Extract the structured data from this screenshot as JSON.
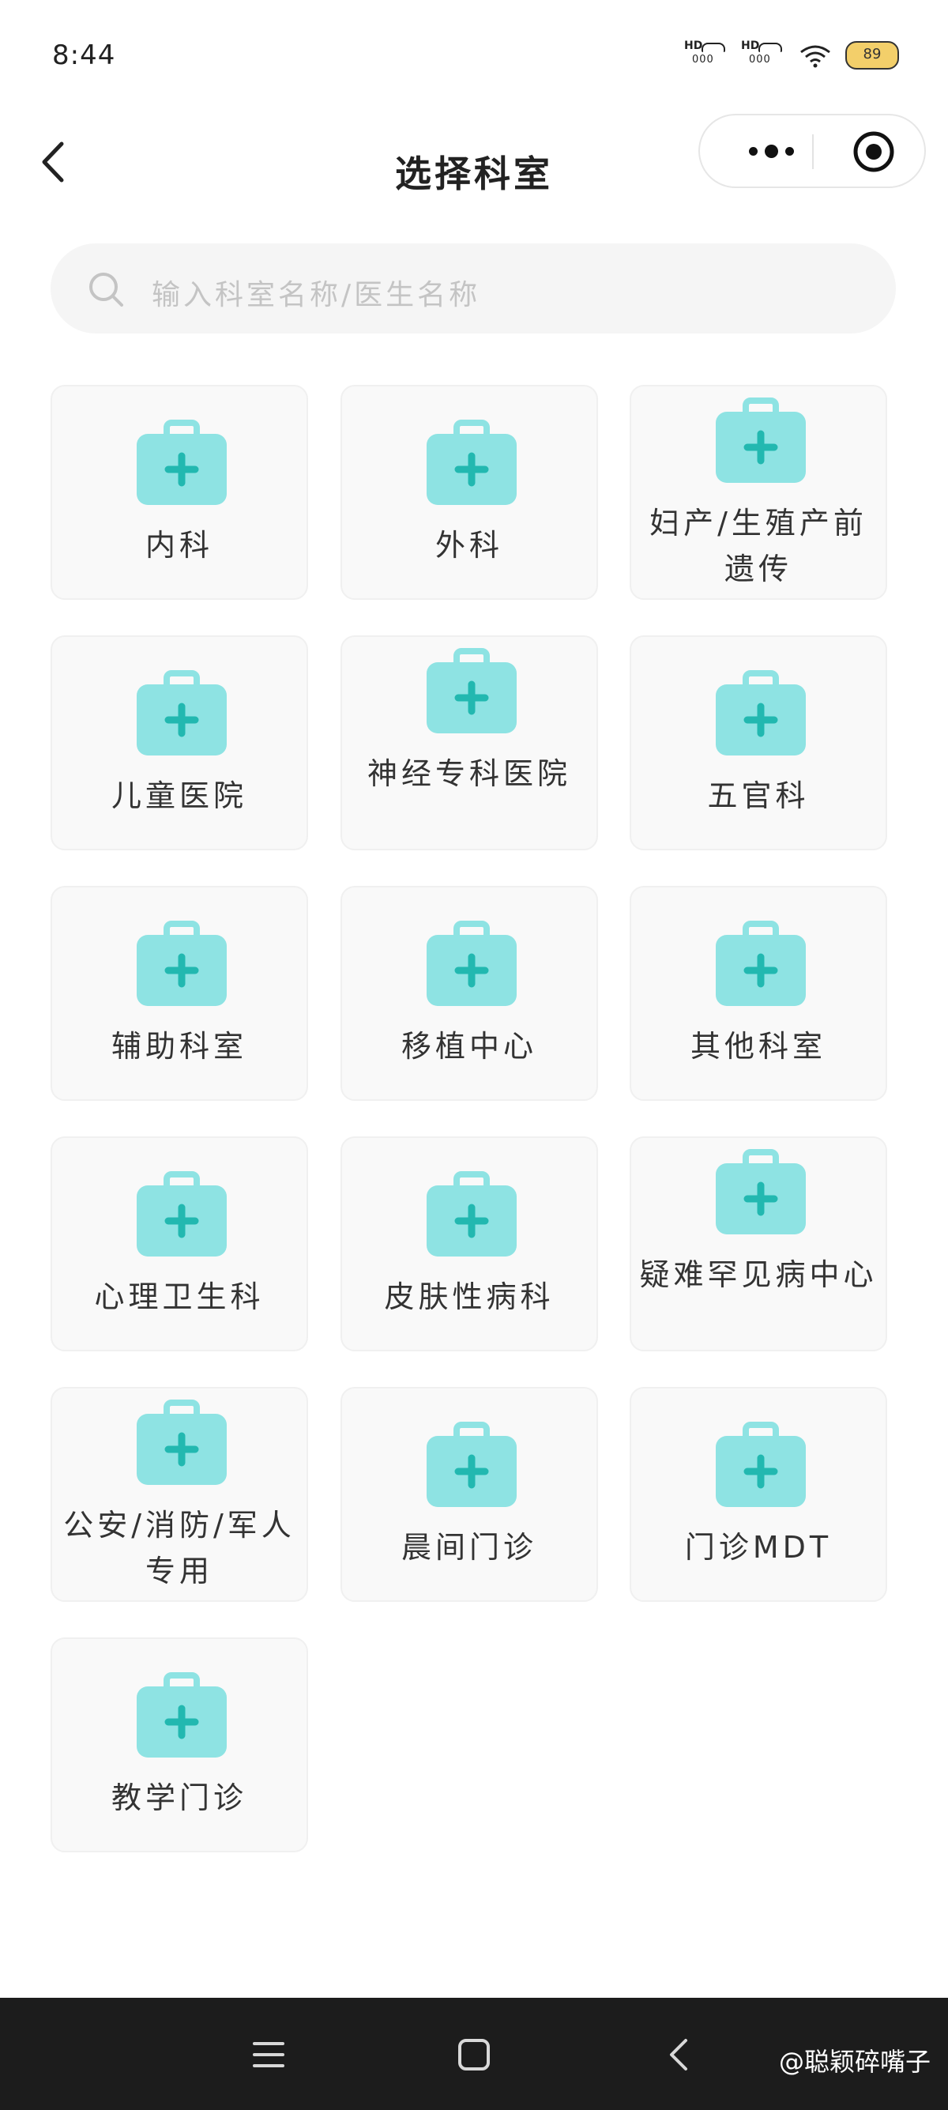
{
  "status_bar": {
    "time": "8:44",
    "battery": "89",
    "signal1": "HD",
    "signal2": "HD"
  },
  "nav": {
    "title": "选择科室"
  },
  "search": {
    "placeholder": "输入科室名称/医生名称"
  },
  "icons": {
    "back": "chevron-left-icon",
    "more": "more-dots-icon",
    "close": "target-circle-icon",
    "search": "search-icon",
    "department": "medical-kit-icon",
    "menu": "menu-icon",
    "home": "home-square-icon",
    "sys_back": "back-arrow-icon"
  },
  "colors": {
    "icon_fill": "#8ee3e3",
    "icon_cross": "#22b8b0",
    "card_bg": "#f9f9f9",
    "nav_bg": "#1c1c1c"
  },
  "departments": [
    {
      "label": "内科"
    },
    {
      "label": "外科"
    },
    {
      "label": "妇产/生殖产前遗传"
    },
    {
      "label": "儿童医院"
    },
    {
      "label": "神经专科医院"
    },
    {
      "label": "五官科"
    },
    {
      "label": "辅助科室"
    },
    {
      "label": "移植中心"
    },
    {
      "label": "其他科室"
    },
    {
      "label": "心理卫生科"
    },
    {
      "label": "皮肤性病科"
    },
    {
      "label": "疑难罕见病中心"
    },
    {
      "label": "公安/消防/军人专用"
    },
    {
      "label": "晨间门诊"
    },
    {
      "label": "门诊MDT"
    },
    {
      "label": "教学门诊"
    }
  ],
  "watermark": "@聪颖碎嘴子"
}
